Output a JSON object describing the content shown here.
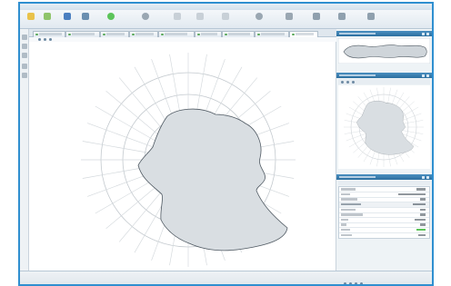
{
  "colors": {
    "accent": "#2f8fd0",
    "shape_fill": "#d9dee2",
    "shape_stroke": "#4f5962",
    "grid": "#c3c9ce",
    "ok_green": "#5cc45a"
  },
  "menu": [
    "",
    "",
    "",
    "",
    "",
    "",
    "",
    ""
  ],
  "toolbar": {
    "buttons": [
      {
        "label": "",
        "icon": "star-icon"
      },
      {
        "label": "",
        "icon": "pencil-icon"
      },
      {
        "label": "",
        "icon": "save-icon"
      },
      {
        "label": "",
        "icon": "printer-icon"
      },
      {
        "label": "",
        "icon": "checkmark-icon"
      },
      {
        "label": "",
        "icon": "gear-icon"
      },
      {
        "label": "",
        "icon": "undo-icon"
      },
      {
        "label": "",
        "icon": "pencil-icon"
      },
      {
        "label": "",
        "icon": "grid-icon"
      },
      {
        "label": "",
        "icon": "crosshair-icon"
      },
      {
        "label": "",
        "icon": "zoom-icon"
      },
      {
        "label": "",
        "icon": "edit-icon"
      },
      {
        "label": "",
        "icon": "wand-icon"
      },
      {
        "label": "",
        "icon": "measure-icon"
      }
    ]
  },
  "tabs": [
    "",
    "",
    "",
    "",
    "",
    "",
    "",
    "",
    ""
  ],
  "properties": {
    "title": "",
    "rows": [
      {
        "key": "",
        "value": ""
      },
      {
        "key": "",
        "value": ""
      },
      {
        "key": "",
        "value": ""
      },
      {
        "key": "",
        "value": ""
      },
      {
        "key": "",
        "value": ""
      },
      {
        "key": "",
        "value": ""
      },
      {
        "key": "",
        "value": ""
      },
      {
        "key": "",
        "value": ""
      },
      {
        "key": "",
        "value": ""
      },
      {
        "key": "",
        "value": ""
      }
    ]
  },
  "panels": {
    "overview_title": "",
    "preview_title": ""
  }
}
